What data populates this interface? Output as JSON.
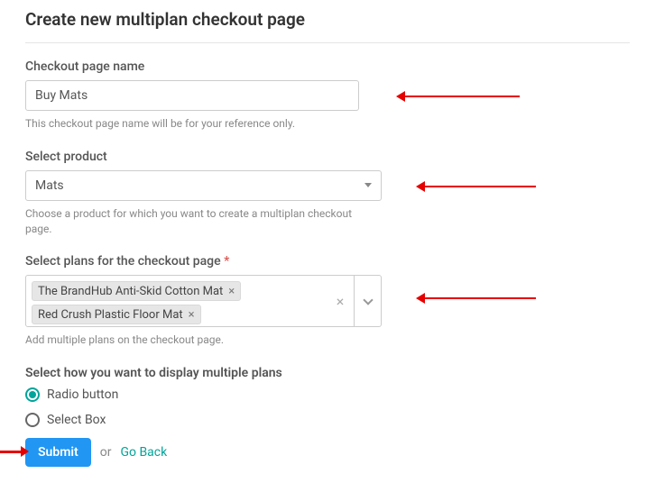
{
  "title": "Create new multiplan checkout page",
  "fields": {
    "name": {
      "label": "Checkout page name",
      "value": "Buy Mats",
      "help": "This checkout page name will be for your reference only."
    },
    "product": {
      "label": "Select product",
      "value": "Mats",
      "help": "Choose a product for which you want to create a multiplan checkout page."
    },
    "plans": {
      "label": "Select plans for the checkout page",
      "required": "*",
      "tags": [
        "The BrandHub Anti-Skid Cotton Mat",
        "Red Crush Plastic Floor Mat"
      ],
      "help": "Add multiple plans on the checkout page."
    },
    "display": {
      "label": "Select how you want to display multiple plans",
      "option1": "Radio button",
      "option2": "Select Box"
    }
  },
  "actions": {
    "submit": "Submit",
    "or": "or",
    "goback": "Go Back"
  }
}
